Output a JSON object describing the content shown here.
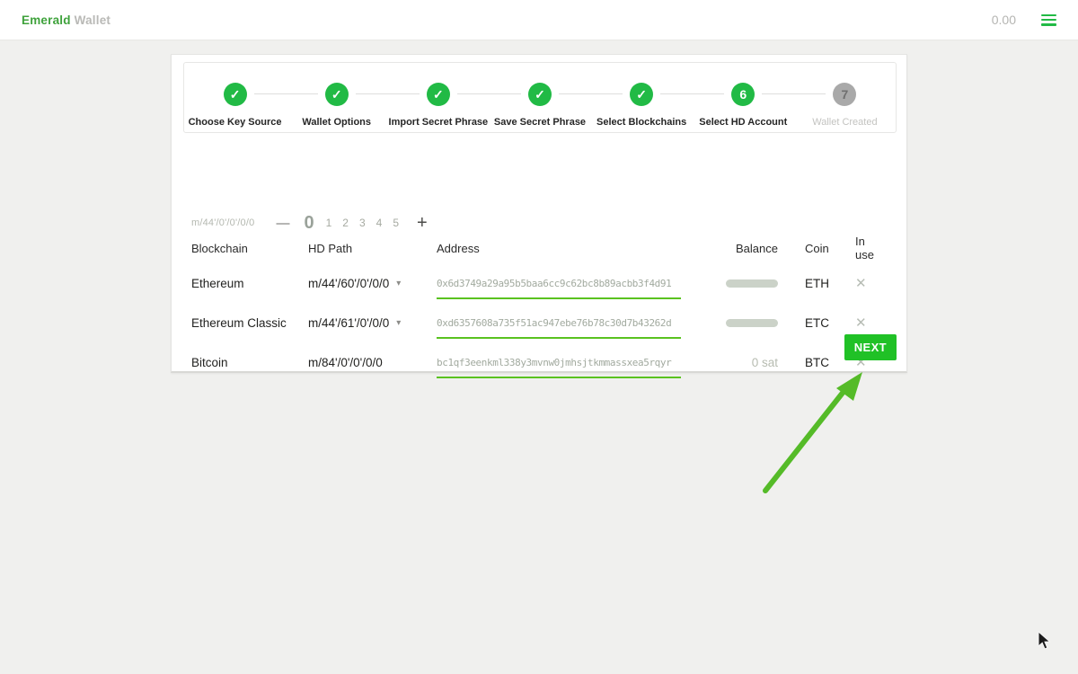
{
  "topbar": {
    "brand_primary": "Emerald",
    "brand_secondary": "Wallet",
    "total_balance": "0.00"
  },
  "icons": {
    "check": "✓",
    "close": "✕",
    "dropdown": "▾"
  },
  "stepper": {
    "steps": [
      {
        "label": "Choose Key Source",
        "state": "completed"
      },
      {
        "label": "Wallet Options",
        "state": "completed"
      },
      {
        "label": "Import Secret Phrase",
        "state": "completed"
      },
      {
        "label": "Save Secret Phrase",
        "state": "completed"
      },
      {
        "label": "Select Blockchains",
        "state": "completed"
      },
      {
        "label": "Select HD Account",
        "state": "active",
        "number": "6"
      },
      {
        "label": "Wallet Created",
        "state": "pending",
        "number": "7"
      }
    ]
  },
  "account_selector": {
    "base_hd_path": "m/44'/0'/0'/0/0",
    "minus_label": "—",
    "plus_label": "+",
    "accounts": [
      "0",
      "1",
      "2",
      "3",
      "4",
      "5"
    ],
    "selected_account": "0"
  },
  "table": {
    "headers": {
      "blockchain": "Blockchain",
      "hd_path": "HD Path",
      "address": "Address",
      "balance": "Balance",
      "coin": "Coin",
      "in_use": "In use"
    },
    "rows": [
      {
        "blockchain": "Ethereum",
        "hd_path": "m/44'/60'/0'/0/0",
        "address": "0x6d3749a29a95b5baa6cc9c62bc8b89acbb3f4d91",
        "balance": "",
        "coin": "ETH"
      },
      {
        "blockchain": "Ethereum Classic",
        "hd_path": "m/44'/61'/0'/0/0",
        "address": "0xd6357608a735f51ac947ebe76b78c30d7b43262d",
        "balance": "",
        "coin": "ETC"
      },
      {
        "blockchain": "Bitcoin",
        "hd_path": "m/84'/0'/0'/0/0",
        "address": "bc1qf3eenkml338y3mvnw0jmhsjtkmmassxea5rqyr",
        "balance": "0 sat",
        "coin": "BTC"
      }
    ]
  },
  "actions": {
    "next_label": "NEXT"
  },
  "colors": {
    "brand_green": "#3fa23c",
    "step_green": "#21ba45",
    "button_green": "#20c126",
    "underline_green": "#5ac220",
    "arrow_green": "#55bb28",
    "pending_gray": "#a9a9a9",
    "background": "#f0f0ee"
  }
}
